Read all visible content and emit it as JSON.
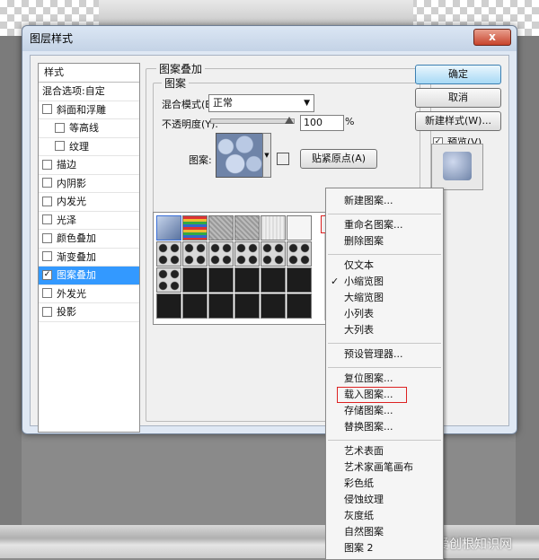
{
  "dialog": {
    "title": "图层样式",
    "close": "x"
  },
  "styles": {
    "header": "样式",
    "blend_options": "混合选项:自定",
    "items": [
      {
        "label": "斜面和浮雕",
        "checked": false,
        "sub": false
      },
      {
        "label": "等高线",
        "checked": false,
        "sub": true
      },
      {
        "label": "纹理",
        "checked": false,
        "sub": true
      },
      {
        "label": "描边",
        "checked": false,
        "sub": false
      },
      {
        "label": "内阴影",
        "checked": false,
        "sub": false
      },
      {
        "label": "内发光",
        "checked": false,
        "sub": false
      },
      {
        "label": "光泽",
        "checked": false,
        "sub": false
      },
      {
        "label": "颜色叠加",
        "checked": false,
        "sub": false
      },
      {
        "label": "渐变叠加",
        "checked": false,
        "sub": false
      },
      {
        "label": "图案叠加",
        "checked": true,
        "sub": false,
        "selected": true
      },
      {
        "label": "外发光",
        "checked": false,
        "sub": false
      },
      {
        "label": "投影",
        "checked": false,
        "sub": false
      }
    ]
  },
  "panel": {
    "group_title": "图案叠加",
    "sub_group": "图案",
    "blend_mode_label": "混合模式(B):",
    "blend_mode_value": "正常",
    "opacity_label": "不透明度(Y):",
    "opacity_value": "100",
    "opacity_level": 1.0,
    "percent": "%",
    "pattern_label": "图案:",
    "snap_button": "贴紧原点(A)",
    "percent2": "%"
  },
  "buttons": {
    "ok": "确定",
    "cancel": "取消",
    "new_style": "新建样式(W)...",
    "preview_label": "预览(V)",
    "preview_checked": "✓"
  },
  "menu": {
    "new_pattern": "新建图案...",
    "rename": "重命名图案...",
    "delete": "删除图案",
    "text_only": "仅文本",
    "small_thumb": "小缩览图",
    "small_thumb_checked": "✓",
    "large_thumb": "大缩览图",
    "small_list": "小列表",
    "large_list": "大列表",
    "preset_manager": "预设管理器...",
    "reset": "复位图案...",
    "load": "载入图案...",
    "save": "存储图案...",
    "replace": "替换图案...",
    "art_surface": "艺术表面",
    "art_brush_canvas": "艺术家画笔画布",
    "color_paper": "彩色纸",
    "erosion": "侵蚀纹理",
    "gray_paper": "灰度纸",
    "nature": "自然图案",
    "pattern2": "图案 2"
  },
  "watermark": "爱创根知识网"
}
